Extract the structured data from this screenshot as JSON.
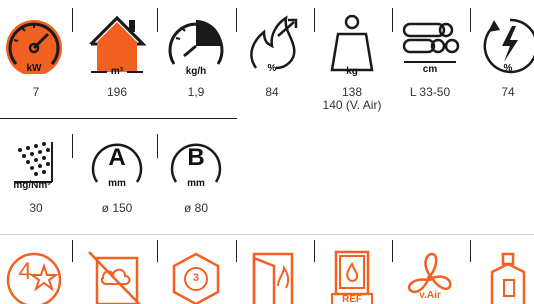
{
  "colors": {
    "accent": "#F26122",
    "ink": "#1a1a1a"
  },
  "row1": [
    {
      "icon": "power-gauge-icon",
      "unit": "kW",
      "value": "7"
    },
    {
      "icon": "house-icon",
      "unit": "m³",
      "value": "196"
    },
    {
      "icon": "consumption-gauge-icon",
      "unit": "kg/h",
      "value": "1,9"
    },
    {
      "icon": "flame-efficiency-icon",
      "unit": "%",
      "value": "84"
    },
    {
      "icon": "weight-icon",
      "unit": "kg",
      "value": "138",
      "value2": "140 (V. Air)"
    },
    {
      "icon": "logs-icon",
      "unit": "cm",
      "value": "L 33-50"
    },
    {
      "icon": "lightning-efficiency-icon",
      "unit": "%",
      "value": "74"
    }
  ],
  "row2": [
    {
      "icon": "particles-icon",
      "unit": "mg/Nm³",
      "value": "30"
    },
    {
      "icon": "flue-a-icon",
      "letter": "A",
      "unit": "mm",
      "value": "ø 150"
    },
    {
      "icon": "flue-b-icon",
      "letter": "B",
      "unit": "mm",
      "value": "ø 80"
    }
  ],
  "row3": [
    {
      "icon": "four-star-icon",
      "label": "4"
    },
    {
      "icon": "no-cleaning-icon"
    },
    {
      "icon": "hexagon-3-icon",
      "label": "3"
    },
    {
      "icon": "door-icon"
    },
    {
      "icon": "ref-fire-icon",
      "label": "REF"
    },
    {
      "icon": "fan-icon",
      "label": "v.Air"
    },
    {
      "icon": "tank-icon"
    }
  ]
}
